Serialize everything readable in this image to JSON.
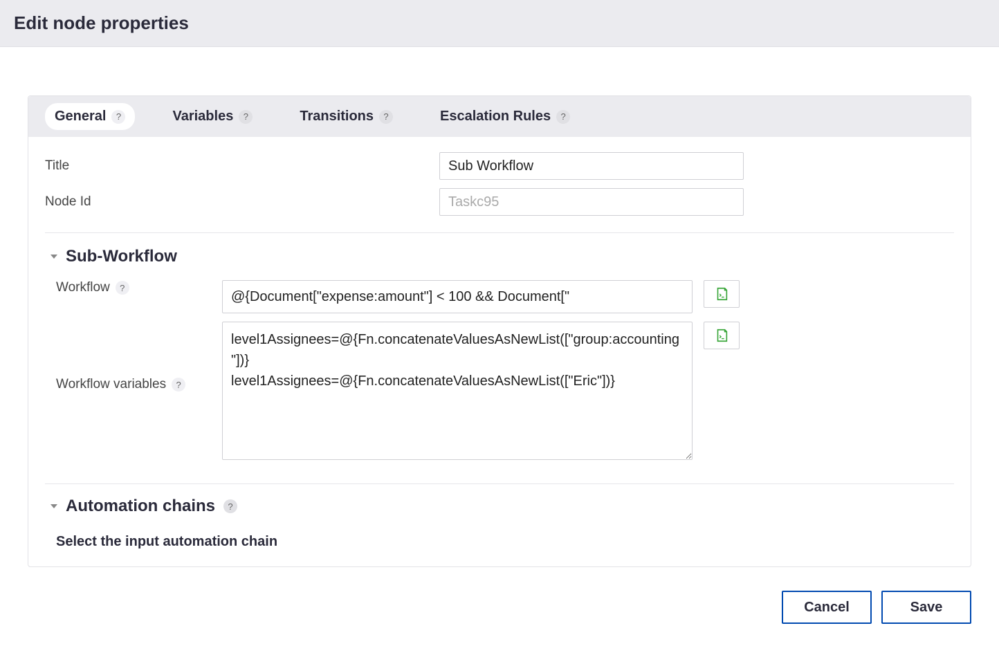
{
  "dialog": {
    "title": "Edit node properties"
  },
  "tabs": {
    "general": "General",
    "variables": "Variables",
    "transitions": "Transitions",
    "escalation": "Escalation Rules"
  },
  "form": {
    "title_label": "Title",
    "title_value": "Sub Workflow",
    "nodeid_label": "Node Id",
    "nodeid_value": "Taskc95"
  },
  "sections": {
    "subworkflow": {
      "title": "Sub-Workflow",
      "workflow_label": "Workflow",
      "workflow_value": "@{Document[\"expense:amount\"] < 100 && Document[\"",
      "vars_label": "Workflow variables",
      "vars_value": "level1Assignees=@{Fn.concatenateValuesAsNewList([\"group:accounting\"])}\nlevel1Assignees=@{Fn.concatenateValuesAsNewList([\"Eric\"])}"
    },
    "automation": {
      "title": "Automation chains",
      "hint": "Select the input automation chain"
    }
  },
  "actions": {
    "cancel": "Cancel",
    "save": "Save"
  },
  "help_glyph": "?"
}
